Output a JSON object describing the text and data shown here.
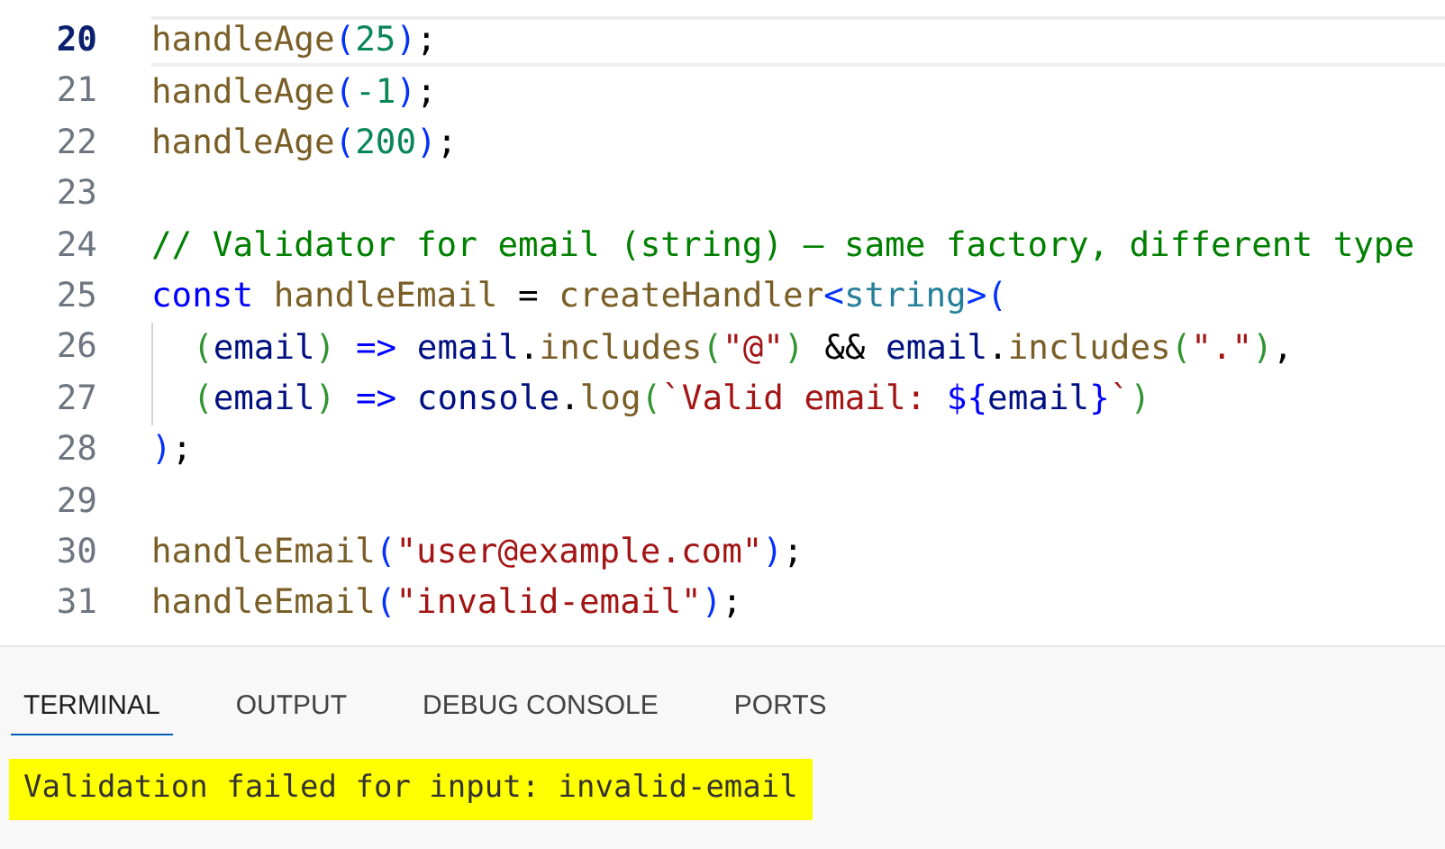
{
  "editor": {
    "lines": [
      {
        "number": "20",
        "current": true,
        "indented": false,
        "tokens": [
          {
            "kind": "function",
            "text": "handleAge"
          },
          {
            "kind": "bracket",
            "text": "("
          },
          {
            "kind": "number",
            "text": "25"
          },
          {
            "kind": "bracket",
            "text": ")"
          },
          {
            "kind": "plain",
            "text": ";"
          }
        ]
      },
      {
        "number": "21",
        "current": false,
        "indented": false,
        "tokens": [
          {
            "kind": "function",
            "text": "handleAge"
          },
          {
            "kind": "bracket",
            "text": "("
          },
          {
            "kind": "number",
            "text": "-1"
          },
          {
            "kind": "bracket",
            "text": ")"
          },
          {
            "kind": "plain",
            "text": ";"
          }
        ]
      },
      {
        "number": "22",
        "current": false,
        "indented": false,
        "tokens": [
          {
            "kind": "function",
            "text": "handleAge"
          },
          {
            "kind": "bracket",
            "text": "("
          },
          {
            "kind": "number",
            "text": "200"
          },
          {
            "kind": "bracket",
            "text": ")"
          },
          {
            "kind": "plain",
            "text": ";"
          }
        ]
      },
      {
        "number": "23",
        "current": false,
        "indented": false
      },
      {
        "number": "24",
        "current": false,
        "indented": false,
        "tokens": [
          {
            "kind": "comment",
            "text": "// Validator for email (string) — same factory, different type"
          }
        ]
      },
      {
        "number": "25",
        "current": false,
        "indented": false,
        "tokens": [
          {
            "kind": "keyword",
            "text": "const "
          },
          {
            "kind": "function",
            "text": "handleEmail"
          },
          {
            "kind": "plain",
            "text": " = "
          },
          {
            "kind": "function",
            "text": "createHandler"
          },
          {
            "kind": "bracket",
            "text": "<"
          },
          {
            "kind": "type",
            "text": "string"
          },
          {
            "kind": "bracket",
            "text": ">("
          }
        ]
      },
      {
        "number": "26",
        "current": false,
        "indented": true,
        "tokens": [
          {
            "kind": "inner-bracket",
            "text": "("
          },
          {
            "kind": "variable",
            "text": "email"
          },
          {
            "kind": "inner-bracket",
            "text": ") "
          },
          {
            "kind": "keyword",
            "text": "=> "
          },
          {
            "kind": "variable",
            "text": "email"
          },
          {
            "kind": "plain",
            "text": "."
          },
          {
            "kind": "function",
            "text": "includes"
          },
          {
            "kind": "inner-bracket",
            "text": "("
          },
          {
            "kind": "string",
            "text": "\"@\""
          },
          {
            "kind": "inner-bracket",
            "text": ")"
          },
          {
            "kind": "plain",
            "text": " && "
          },
          {
            "kind": "variable",
            "text": "email"
          },
          {
            "kind": "plain",
            "text": "."
          },
          {
            "kind": "function",
            "text": "includes"
          },
          {
            "kind": "inner-bracket",
            "text": "("
          },
          {
            "kind": "string",
            "text": "\".\""
          },
          {
            "kind": "inner-bracket",
            "text": ")"
          },
          {
            "kind": "plain",
            "text": ","
          }
        ]
      },
      {
        "number": "27",
        "current": false,
        "indented": true,
        "tokens": [
          {
            "kind": "inner-bracket",
            "text": "("
          },
          {
            "kind": "variable",
            "text": "email"
          },
          {
            "kind": "inner-bracket",
            "text": ") "
          },
          {
            "kind": "keyword",
            "text": "=> "
          },
          {
            "kind": "variable",
            "text": "console"
          },
          {
            "kind": "plain",
            "text": "."
          },
          {
            "kind": "function",
            "text": "log"
          },
          {
            "kind": "inner-bracket",
            "text": "("
          },
          {
            "kind": "string",
            "text": "`Valid email: "
          },
          {
            "kind": "keyword",
            "text": "${"
          },
          {
            "kind": "variable",
            "text": "email"
          },
          {
            "kind": "keyword",
            "text": "}"
          },
          {
            "kind": "string",
            "text": "`"
          },
          {
            "kind": "inner-bracket",
            "text": ")"
          }
        ]
      },
      {
        "number": "28",
        "current": false,
        "indented": false,
        "tokens": [
          {
            "kind": "bracket",
            "text": ")"
          },
          {
            "kind": "plain",
            "text": ";"
          }
        ]
      },
      {
        "number": "29",
        "current": false,
        "indented": false
      },
      {
        "number": "30",
        "current": false,
        "indented": false,
        "tokens": [
          {
            "kind": "function",
            "text": "handleEmail"
          },
          {
            "kind": "bracket",
            "text": "("
          },
          {
            "kind": "string",
            "text": "\"user@example.com\""
          },
          {
            "kind": "bracket",
            "text": ")"
          },
          {
            "kind": "plain",
            "text": ";"
          }
        ]
      },
      {
        "number": "31",
        "current": false,
        "indented": false,
        "tokens": [
          {
            "kind": "function",
            "text": "handleEmail"
          },
          {
            "kind": "bracket",
            "text": "("
          },
          {
            "kind": "string",
            "text": "\"invalid-email\""
          },
          {
            "kind": "bracket",
            "text": ")"
          },
          {
            "kind": "plain",
            "text": ";"
          }
        ]
      }
    ]
  },
  "panel": {
    "tabs": [
      {
        "label": "TERMINAL",
        "selected": true
      },
      {
        "label": "OUTPUT",
        "selected": false
      },
      {
        "label": "DEBUG CONSOLE",
        "selected": false
      },
      {
        "label": "PORTS",
        "selected": false
      }
    ],
    "terminal": {
      "lines": [
        {
          "text": "Validation failed for input: invalid-email",
          "highlighted": true
        }
      ]
    }
  }
}
